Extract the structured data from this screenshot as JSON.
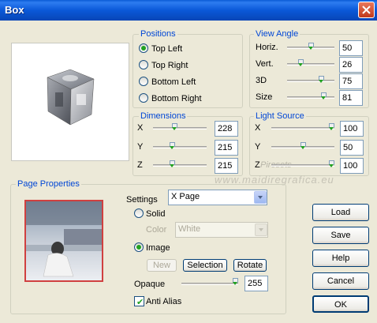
{
  "window": {
    "title": "Box"
  },
  "positions": {
    "title": "Positions",
    "options": [
      "Top Left",
      "Top Right",
      "Bottom Left",
      "Bottom Right"
    ],
    "selected": 0
  },
  "view_angle": {
    "title": "View Angle",
    "rows": [
      {
        "label": "Horiz.",
        "value": "50",
        "level": 0.5
      },
      {
        "label": "Vert.",
        "value": "26",
        "level": 0.26
      },
      {
        "label": "3D",
        "value": "75",
        "level": 0.75
      },
      {
        "label": "Size",
        "value": "81",
        "level": 0.81
      }
    ]
  },
  "dimensions": {
    "title": "Dimensions",
    "rows": [
      {
        "label": "X",
        "value": "228",
        "level": 0.4
      },
      {
        "label": "Y",
        "value": "215",
        "level": 0.35
      },
      {
        "label": "Z",
        "value": "215",
        "level": 0.35
      }
    ]
  },
  "light_source": {
    "title": "Light Source",
    "rows": [
      {
        "label": "X",
        "value": "100",
        "level": 1.0
      },
      {
        "label": "Y",
        "value": "50",
        "level": 0.5
      },
      {
        "label": "Z",
        "value": "100",
        "level": 1.0
      }
    ]
  },
  "page_properties": {
    "title": "Page Properties",
    "settings_label": "Settings",
    "settings_value": "X Page",
    "solid_label": "Solid",
    "color_label": "Color",
    "color_value": "White",
    "image_label": "Image",
    "new_label": "New",
    "selection_label": "Selection",
    "rotate_label": "Rotate",
    "opaque_label": "Opaque",
    "opaque_value": "255",
    "opaque_level": 1.0,
    "anti_alias_label": "Anti Alias",
    "anti_alias_checked": true
  },
  "buttons": {
    "load": "Load",
    "save": "Save",
    "help": "Help",
    "cancel": "Cancel",
    "ok": "OK"
  },
  "watermark": {
    "line1": "Pirosets",
    "line2": "www.maidiregrafica.eu"
  },
  "colors": {
    "accent_green": "#21a121",
    "group_title": "#0046d5",
    "titlebar": "#0a58d8"
  }
}
